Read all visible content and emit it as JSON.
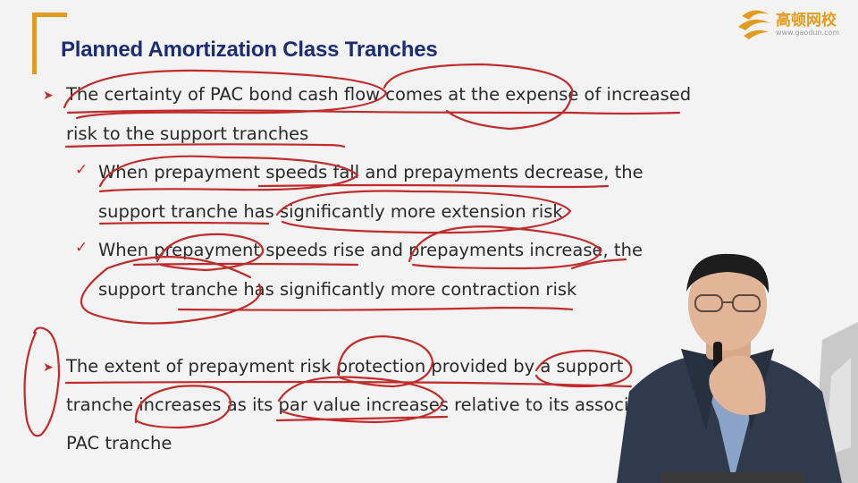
{
  "slide": {
    "title": "Planned Amortization Class Tranches",
    "logo": {
      "name": "高顿网校",
      "url": "www.gaodun.com"
    },
    "bullets": [
      {
        "lines": [
          "The certainty of PAC bond cash flow comes at the expense of increased",
          "risk to the support tranches"
        ]
      },
      {
        "sub": [
          [
            "When prepayment speeds fall and prepayments decrease, the",
            "support tranche has significantly more extension risk"
          ],
          [
            "When prepayment speeds rise and prepayments increase, the",
            "support tranche has significantly more contraction risk"
          ]
        ]
      },
      {
        "lines": [
          "The extent of prepayment risk protection provided by a support",
          "tranche increases as its par value increases relative to its associa",
          "PAC tranche"
        ]
      }
    ]
  },
  "colors": {
    "title": "#1c2d73",
    "accent": "#e39b1f",
    "ink": "#c22b2b",
    "text": "#2a2a2a"
  },
  "icons": [
    "bullet-arrow-icon",
    "checkmark-icon",
    "gaodun-logo-icon"
  ]
}
